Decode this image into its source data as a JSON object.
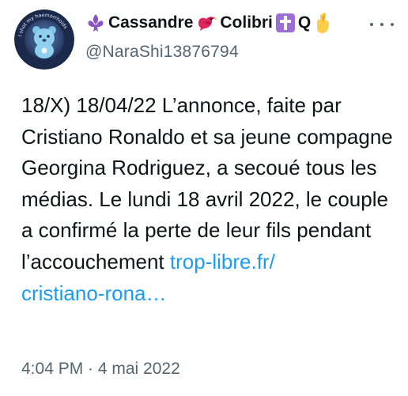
{
  "author": {
    "display_name_parts": [
      "Cassandre",
      "Colibri",
      "Q"
    ],
    "handle": "@NaraShi13876794",
    "avatar_caption": "I shot my haemorrhoids",
    "avatar_icon": "care-bear-avatar",
    "name_icons": [
      "fleur-de-lis-icon",
      "red-bird-icon",
      "latin-cross-icon",
      "crossed-fingers-icon"
    ]
  },
  "tweet": {
    "text": "18/X) 18/04/22 L’annonce, faite par Cristiano Ronaldo et sa jeune compagne Georgina Rodriguez, a secoué tous les médias. Le lundi 18 avril 2022, le couple a confirmé la perte de leur fils pendant l’accouchement ",
    "link_text": "trop-libre.fr/\ncristiano-rona…",
    "timestamp": "4:04 PM · 4 mai 2022"
  },
  "colors": {
    "text": "#0f1419",
    "secondary": "#536471",
    "link": "#1d9bf0",
    "fleur_de_lis": "#8a55c7",
    "bird": "#e0245e",
    "cross_bg": "#9b6fd6",
    "hand": "#ffcc4d"
  }
}
